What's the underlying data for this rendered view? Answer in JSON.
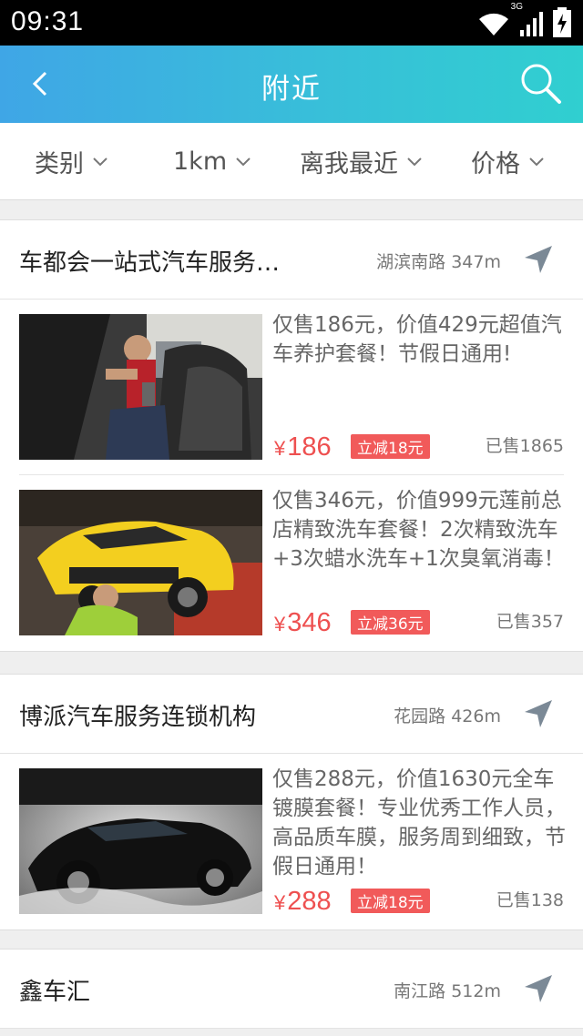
{
  "status_bar": {
    "time": "09:31",
    "network": "3G"
  },
  "nav": {
    "title": "附近"
  },
  "filters": [
    {
      "label": "类别"
    },
    {
      "label": "1km"
    },
    {
      "label": "离我最近"
    },
    {
      "label": "价格"
    }
  ],
  "stores": [
    {
      "name": "车都会一站式汽车服务…",
      "location": "湖滨南路 347m",
      "deals": [
        {
          "title": "仅售186元，价值429元超值汽车养护套餐！节假日通用!",
          "currency": "¥",
          "price": "186",
          "discount": "立减18元",
          "sold": "已售1865"
        },
        {
          "title": "仅售346元，价值999元莲前总店精致洗车套餐！2次精致洗车+3次蜡水洗车+1次臭氧消毒！",
          "currency": "¥",
          "price": "346",
          "discount": "立减36元",
          "sold": "已售357"
        }
      ]
    },
    {
      "name": "博派汽车服务连锁机构",
      "location": "花园路 426m",
      "deals": [
        {
          "title": "仅售288元，价值1630元全车镀膜套餐！专业优秀工作人员，高品质车膜，服务周到细致，节假日通用！",
          "currency": "¥",
          "price": "288",
          "discount": "立减18元",
          "sold": "已售138"
        }
      ]
    },
    {
      "name": "鑫车汇",
      "location": "南江路 512m"
    }
  ]
}
